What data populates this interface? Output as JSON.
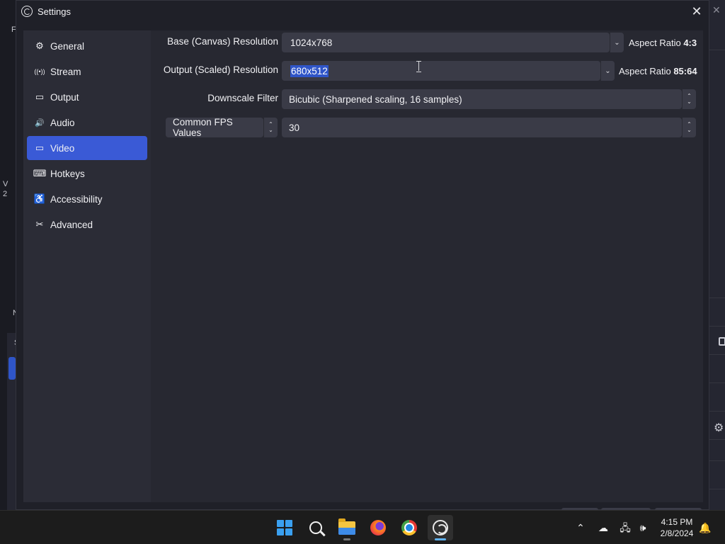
{
  "dialog": {
    "title": "Settings",
    "close_glyph": "✕"
  },
  "sidebar": {
    "items": [
      {
        "label": "General",
        "icon": "gear-icon",
        "glyph": "⚙",
        "active": false
      },
      {
        "label": "Stream",
        "icon": "broadcast-icon",
        "glyph": "((•))",
        "active": false
      },
      {
        "label": "Output",
        "icon": "output-icon",
        "glyph": "▭",
        "active": false
      },
      {
        "label": "Audio",
        "icon": "speaker-icon",
        "glyph": "🔊",
        "active": false
      },
      {
        "label": "Video",
        "icon": "monitor-icon",
        "glyph": "▭",
        "active": true
      },
      {
        "label": "Hotkeys",
        "icon": "keyboard-icon",
        "glyph": "⌨",
        "active": false
      },
      {
        "label": "Accessibility",
        "icon": "accessibility-icon",
        "glyph": "♿",
        "active": false
      },
      {
        "label": "Advanced",
        "icon": "tools-icon",
        "glyph": "✂",
        "active": false
      }
    ]
  },
  "video": {
    "base_label": "Base (Canvas) Resolution",
    "base_value": "1024x768",
    "base_aspect_prefix": "Aspect Ratio",
    "base_aspect_value": "4:3",
    "output_label": "Output (Scaled) Resolution",
    "output_value": "680x512",
    "output_aspect_prefix": "Aspect Ratio",
    "output_aspect_value": "85:64",
    "downscale_label": "Downscale Filter",
    "downscale_value": "Bicubic (Sharpened scaling, 16 samples)",
    "fps_type_value": "Common FPS Values",
    "fps_value": "30"
  },
  "glyphs": {
    "chevron_down": "⌄",
    "spin_up": "⌃",
    "spin_down": "⌄"
  },
  "background": {
    "left_chars": [
      "F",
      "V",
      "2",
      "N",
      "S"
    ],
    "right_close": "✕"
  },
  "taskbar": {
    "apps": [
      {
        "name": "start-button",
        "active": false
      },
      {
        "name": "search-button",
        "active": false
      },
      {
        "name": "file-explorer",
        "active": false,
        "running": true
      },
      {
        "name": "firefox",
        "active": false
      },
      {
        "name": "chrome",
        "active": false
      },
      {
        "name": "obs-studio",
        "active": true
      }
    ],
    "tray": {
      "chevron": "⌃",
      "onedrive_glyph": "☁",
      "network_glyph": "🖧",
      "volume_glyph": "🕪",
      "notification_glyph": "🔔"
    },
    "time": "4:15 PM",
    "date": "2/8/2024"
  }
}
